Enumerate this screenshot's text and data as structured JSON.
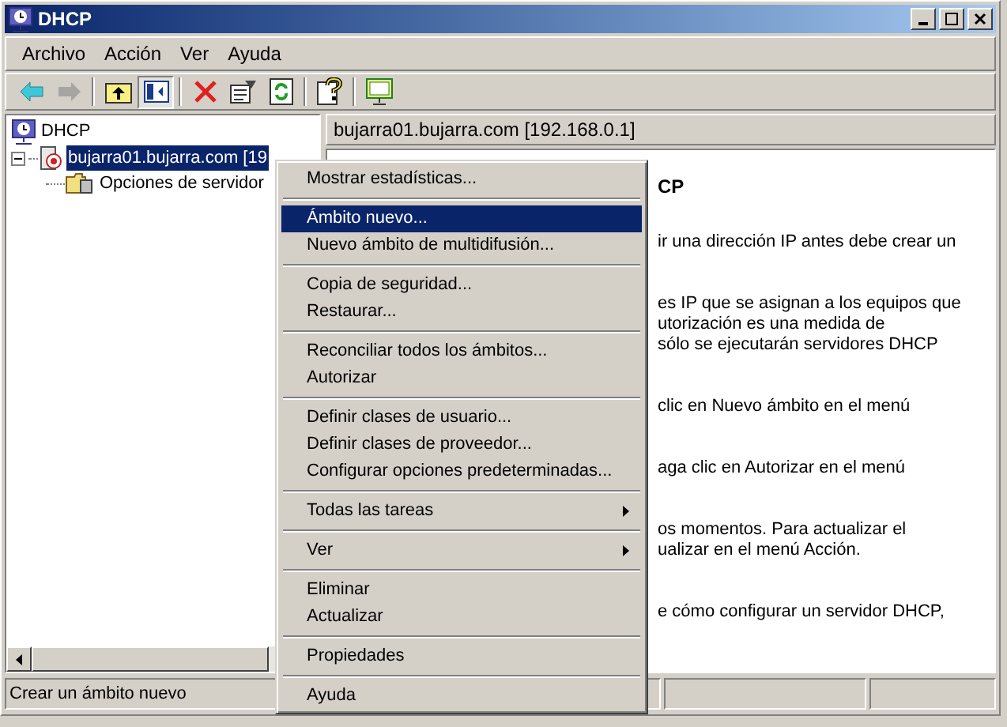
{
  "window": {
    "title": "DHCP"
  },
  "menu_bar": [
    {
      "label": "Archivo"
    },
    {
      "label": "Acción"
    },
    {
      "label": "Ver"
    },
    {
      "label": "Ayuda"
    }
  ],
  "toolbar": [
    {
      "kind": "back",
      "disabled": false,
      "pressed": false
    },
    {
      "kind": "forward",
      "disabled": true,
      "pressed": false
    },
    {
      "kind": "sep"
    },
    {
      "kind": "up",
      "disabled": false,
      "pressed": false
    },
    {
      "kind": "tree",
      "disabled": false,
      "pressed": true
    },
    {
      "kind": "sep"
    },
    {
      "kind": "delete",
      "disabled": false,
      "pressed": false
    },
    {
      "kind": "properties",
      "disabled": false,
      "pressed": false
    },
    {
      "kind": "refresh",
      "disabled": false,
      "pressed": false
    },
    {
      "kind": "sep"
    },
    {
      "kind": "help",
      "disabled": false,
      "pressed": false
    },
    {
      "kind": "sep"
    },
    {
      "kind": "console",
      "disabled": false,
      "pressed": false
    }
  ],
  "tree": {
    "root": "DHCP",
    "items": [
      {
        "label": "bujarra01.bujarra.com [19",
        "selected": true,
        "expanded": true,
        "children": [
          {
            "label": "Opciones de servidor",
            "selected": false
          }
        ]
      }
    ]
  },
  "details": {
    "header": "bujarra01.bujarra.com [192.168.0.1]",
    "heading": "CP",
    "paragraphs": [
      [
        "ir una dirección IP antes debe crear un"
      ],
      [
        "es IP que se asignan a los equipos que",
        "utorización es una medida de",
        "sólo se ejecutarán servidores DHCP"
      ],
      [
        "clic en Nuevo ámbito en el menú"
      ],
      [
        "aga clic en Autorizar en el menú"
      ],
      [
        "os momentos. Para actualizar el",
        "ualizar en el menú Acción."
      ],
      [
        "e cómo configurar un servidor DHCP,"
      ]
    ]
  },
  "context_menu": {
    "groups": [
      [
        {
          "label": "Mostrar estadísticas...",
          "kind": "item",
          "selected": false
        }
      ],
      [
        {
          "label": "Ámbito nuevo...",
          "kind": "item",
          "selected": true
        },
        {
          "label": "Nuevo ámbito de multidifusión...",
          "kind": "item",
          "selected": false
        }
      ],
      [
        {
          "label": "Copia de seguridad...",
          "kind": "item",
          "selected": false
        },
        {
          "label": "Restaurar...",
          "kind": "item",
          "selected": false
        }
      ],
      [
        {
          "label": "Reconciliar todos los ámbitos...",
          "kind": "item",
          "selected": false
        },
        {
          "label": "Autorizar",
          "kind": "item",
          "selected": false
        }
      ],
      [
        {
          "label": "Definir clases de usuario...",
          "kind": "item",
          "selected": false
        },
        {
          "label": "Definir clases de proveedor...",
          "kind": "item",
          "selected": false
        },
        {
          "label": "Configurar opciones predeterminadas...",
          "kind": "item",
          "selected": false
        }
      ],
      [
        {
          "label": "Todas las tareas",
          "kind": "submenu",
          "selected": false
        }
      ],
      [
        {
          "label": "Ver",
          "kind": "submenu",
          "selected": false
        }
      ],
      [
        {
          "label": "Eliminar",
          "kind": "item",
          "selected": false
        },
        {
          "label": "Actualizar",
          "kind": "item",
          "selected": false
        }
      ],
      [
        {
          "label": "Propiedades",
          "kind": "item",
          "selected": false
        }
      ],
      [
        {
          "label": "Ayuda",
          "kind": "item",
          "selected": false
        }
      ]
    ]
  },
  "status_bar": {
    "text": "Crear un ámbito nuevo"
  }
}
